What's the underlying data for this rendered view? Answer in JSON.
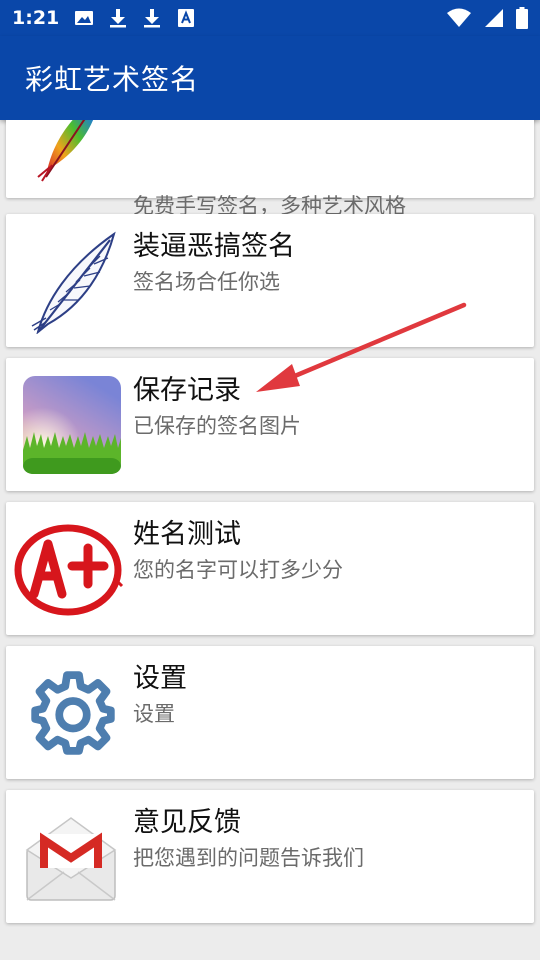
{
  "status_bar": {
    "time": "1:21",
    "icons": [
      "image-icon",
      "download-icon",
      "download-icon",
      "font-icon",
      "wifi-icon",
      "signal-icon",
      "battery-icon"
    ]
  },
  "app_bar": {
    "title": "彩虹艺术签名"
  },
  "menu": {
    "items": [
      {
        "title": "",
        "subtitle": "免费手写签名，多种艺术风格",
        "icon": "rainbow-feather-icon"
      },
      {
        "title": "装逼恶搞签名",
        "subtitle": "签名场合任你选",
        "icon": "feather-quill-icon"
      },
      {
        "title": "保存记录",
        "subtitle": "已保存的签名图片",
        "icon": "landscape-photo-icon"
      },
      {
        "title": "姓名测试",
        "subtitle": "您的名字可以打多少分",
        "icon": "a-plus-grade-icon"
      },
      {
        "title": "设置",
        "subtitle": "设置",
        "icon": "gear-icon"
      },
      {
        "title": "意见反馈",
        "subtitle": "把您遇到的问题告诉我们",
        "icon": "gmail-envelope-icon"
      }
    ]
  },
  "colors": {
    "primary": "#0a47a9",
    "background": "#ececec",
    "card": "#ffffff",
    "annotation_arrow": "#e0393e"
  }
}
